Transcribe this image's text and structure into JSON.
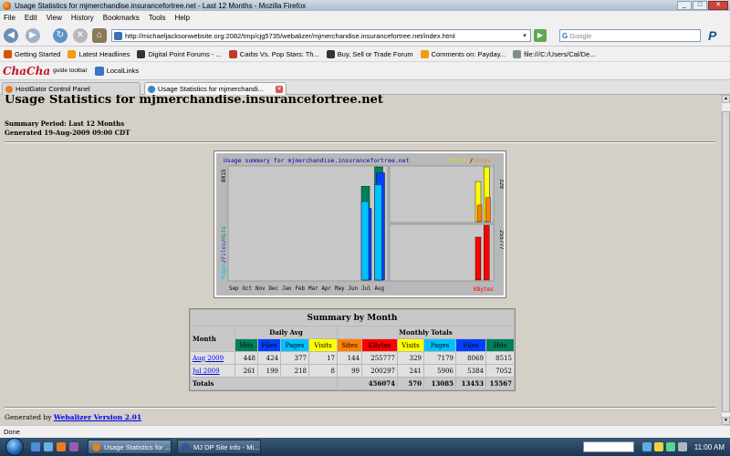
{
  "window": {
    "title": "Usage Statistics for mjmerchandise.insurancefortree.net - Last 12 Months - Mozilla Firefox",
    "min": "_",
    "max": "□",
    "close": "✕"
  },
  "menu": [
    "File",
    "Edit",
    "View",
    "History",
    "Bookmarks",
    "Tools",
    "Help"
  ],
  "nav": {
    "url": "http://michaeljacksonwebsite.org:2082/tmp/cjg5735/webalizer/mjmerchandise.insurancefortree.net/index.html",
    "search_placeholder": "Google",
    "search_engine": "G",
    "go": "▶",
    "back": "◀",
    "forward": "▶",
    "reload": "↻",
    "stop": "✕",
    "home": "⌂",
    "dropdown": "▾",
    "extension": "P"
  },
  "bookmarks": [
    {
      "label": "Getting Started",
      "icon": "firefox-icon",
      "color": "#d35400"
    },
    {
      "label": "Latest Headlines",
      "icon": "rss-icon",
      "color": "#f39c12"
    },
    {
      "label": "Digital Point Forums - ...",
      "icon": "dp-icon",
      "color": "#333333"
    },
    {
      "label": "Carbs Vs. Pop Stars: Th...",
      "icon": "y-icon",
      "color": "#c0392b"
    },
    {
      "label": "Buy, Sell or Trade Forum",
      "icon": "dp-icon",
      "color": "#333333"
    },
    {
      "label": "Comments on: Payday...",
      "icon": "rss-icon",
      "color": "#f39c12"
    },
    {
      "label": "file:///C:/Users/Cal/De...",
      "icon": "file-icon",
      "color": "#7f8c8d"
    }
  ],
  "chacha": {
    "logo": "ChaCha",
    "sub": "guide toolbar",
    "locallinks": "LocalLinks"
  },
  "tabs": [
    {
      "label": "HostGator Control Panel",
      "close": "✕"
    },
    {
      "label": "Usage Statistics for mjmerchandi...",
      "close": "✕"
    }
  ],
  "page": {
    "title": "Usage Statistics for mjmerchandise.insurancefortree.net",
    "period": "Summary Period: Last 12 Months",
    "generated": "Generated 19-Aug-2009 09:00 CDT",
    "footer_prefix": "Generated by ",
    "footer_link": "Webalizer Version 2.01"
  },
  "colors": {
    "hits": "#00805c",
    "files": "#0040ff",
    "pages": "#00c0ff",
    "visits": "#ffff00",
    "sites": "#ff8000",
    "kbytes": "#ff0000"
  },
  "chart_data": {
    "type": "bar",
    "title": "Usage summary for mjmerchandise.insurancefortree.net",
    "legend_visits": "Visits",
    "legend_sites": "Sites",
    "legend_slash": "/",
    "left_axis_label_parts": [
      "Pages",
      "/",
      "Files",
      "/",
      "Hits"
    ],
    "kbytes_label": "KBytes",
    "left_max_label": "8015",
    "visits_max_label": "329",
    "kbytes_max_label": "255777",
    "categories": [
      "Sep",
      "Oct",
      "Nov",
      "Dec",
      "Jan",
      "Feb",
      "Mar",
      "Apr",
      "May",
      "Jun",
      "Jul",
      "Aug"
    ],
    "series": [
      {
        "name": "Hits",
        "values": [
          0,
          0,
          0,
          0,
          0,
          0,
          0,
          0,
          0,
          0,
          7052,
          8515
        ]
      },
      {
        "name": "Files",
        "values": [
          0,
          0,
          0,
          0,
          0,
          0,
          0,
          0,
          0,
          0,
          5384,
          8069
        ]
      },
      {
        "name": "Pages",
        "values": [
          0,
          0,
          0,
          0,
          0,
          0,
          0,
          0,
          0,
          0,
          5906,
          7179
        ]
      },
      {
        "name": "Visits",
        "values": [
          0,
          0,
          0,
          0,
          0,
          0,
          0,
          0,
          0,
          0,
          241,
          329
        ]
      },
      {
        "name": "Sites",
        "values": [
          0,
          0,
          0,
          0,
          0,
          0,
          0,
          0,
          0,
          0,
          99,
          144
        ]
      },
      {
        "name": "KBytes",
        "values": [
          0,
          0,
          0,
          0,
          0,
          0,
          0,
          0,
          0,
          0,
          200297,
          255777
        ]
      }
    ],
    "left_ylim": [
      0,
      8515
    ],
    "visits_ylim": [
      0,
      329
    ],
    "kbytes_ylim": [
      0,
      255777
    ]
  },
  "summary": {
    "caption": "Summary by Month",
    "month_header": "Month",
    "daily_avg": "Daily Avg",
    "monthly_totals": "Monthly Totals",
    "daily_cols": [
      "Hits",
      "Files",
      "Pages",
      "Visits"
    ],
    "monthly_cols": [
      "Sites",
      "KBytes",
      "Visits",
      "Pages",
      "Files",
      "Hits"
    ],
    "rows": [
      {
        "month": "Aug 2009",
        "cells": [
          "448",
          "424",
          "377",
          "17",
          "144",
          "255777",
          "329",
          "7179",
          "8069",
          "8515"
        ]
      },
      {
        "month": "Jul 2009",
        "cells": [
          "261",
          "199",
          "218",
          "8",
          "99",
          "200297",
          "241",
          "5906",
          "5384",
          "7052"
        ]
      }
    ],
    "totals_label": "Totals",
    "totals": [
      "456074",
      "570",
      "13085",
      "13453",
      "15567"
    ]
  },
  "status": "Done",
  "taskbar": {
    "buttons": [
      "Usage Statistics for ...",
      "MJ DP Site info - Mi..."
    ],
    "clock": "11:00 AM"
  }
}
